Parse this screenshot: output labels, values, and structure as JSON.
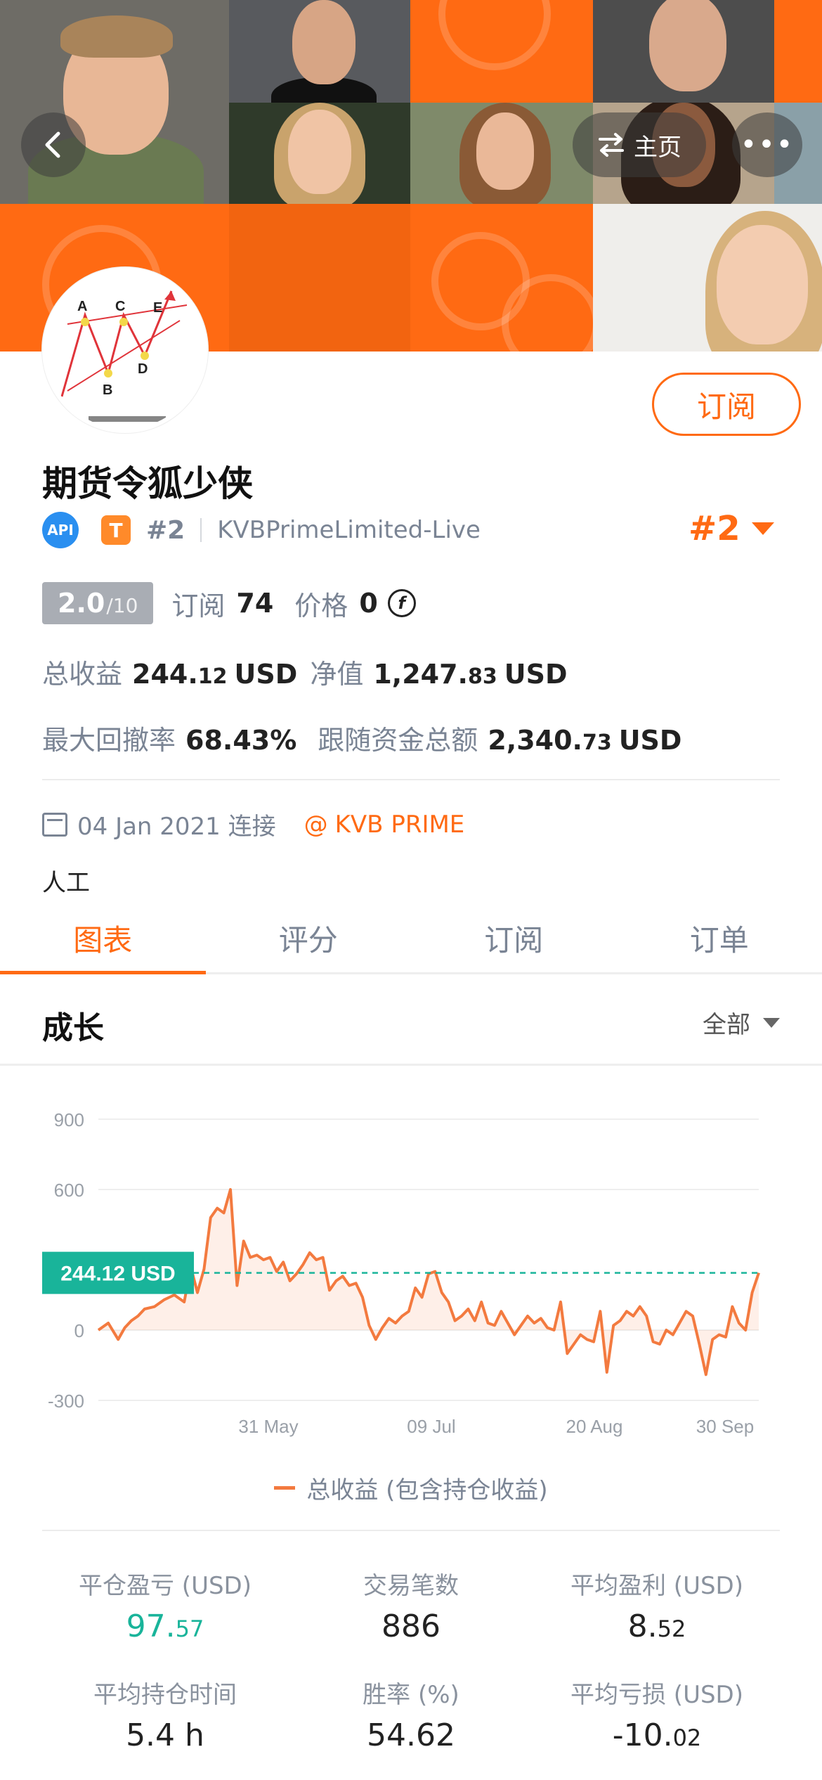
{
  "nav": {
    "home_label": "主页",
    "more_label": "•••"
  },
  "profile": {
    "subscribe_label": "订阅",
    "name": "期货令狐少侠",
    "api_badge": "API",
    "type_badge": "T",
    "rank_small": "#2",
    "server": "KVBPrimeLimited-Live",
    "rank_big": "#2",
    "score": "2.0",
    "score_max": "/10",
    "subscribers_label": "订阅",
    "subscribers": "74",
    "price_label": "价格",
    "price": "0",
    "total_profit_label": "总收益",
    "total_profit_int": "244.",
    "total_profit_dec": "12",
    "total_profit_cur": "USD",
    "equity_label": "净值",
    "equity_int": "1,247.",
    "equity_dec": "83",
    "equity_cur": "USD",
    "max_dd_label": "最大回撤率",
    "max_dd": "68.43%",
    "follow_label": "跟随资金总额",
    "follow_int": "2,340.",
    "follow_dec": "73",
    "follow_cur": "USD",
    "join_date": "04 Jan 2021 连接",
    "broker": "KVB PRIME",
    "strategy_type": "人工"
  },
  "tabs": [
    "图表",
    "评分",
    "订阅",
    "订单"
  ],
  "section": {
    "title": "成长",
    "range": "全部"
  },
  "chart_data": {
    "type": "line",
    "title": "",
    "y_ticks": [
      900,
      600,
      0,
      -300
    ],
    "x_labels": [
      "31 May",
      "09 Jul",
      "20 Aug",
      "30 Sep"
    ],
    "ylim": [
      -300,
      900
    ],
    "current_value_label": "244.12 USD",
    "current_value": 244.12,
    "series": [
      {
        "name": "总收益 (包含持仓收益)",
        "color": "#f37a3f",
        "x": [
          0,
          3,
          6,
          8,
          10,
          12,
          14,
          17,
          20,
          23,
          26,
          28,
          30,
          32,
          34,
          36,
          38,
          40,
          42,
          44,
          46,
          48,
          50,
          52,
          54,
          56,
          58,
          60,
          62,
          64,
          66,
          68,
          70,
          72,
          74,
          76,
          78,
          80,
          82,
          84,
          86,
          88,
          90,
          92,
          94,
          96,
          98,
          100,
          102,
          104,
          106,
          108,
          110,
          112,
          114,
          116,
          118,
          120,
          122,
          124,
          126,
          128,
          130,
          132,
          134,
          136,
          138,
          140,
          142,
          144,
          146,
          148,
          150,
          152,
          154,
          156,
          158,
          160,
          162,
          164,
          166,
          168,
          170,
          172,
          174,
          176,
          178,
          180,
          182,
          184,
          186,
          188,
          190,
          192,
          194,
          196,
          198,
          200
        ],
        "values": [
          0,
          30,
          -40,
          10,
          40,
          60,
          90,
          100,
          130,
          150,
          120,
          270,
          160,
          260,
          480,
          520,
          500,
          600,
          190,
          380,
          310,
          320,
          300,
          310,
          250,
          290,
          210,
          240,
          280,
          330,
          300,
          310,
          170,
          210,
          230,
          190,
          200,
          140,
          20,
          -40,
          10,
          50,
          30,
          60,
          80,
          180,
          140,
          240,
          250,
          160,
          120,
          40,
          60,
          90,
          40,
          120,
          30,
          20,
          80,
          30,
          -20,
          20,
          60,
          30,
          50,
          10,
          0,
          120,
          -100,
          -60,
          -20,
          -40,
          -50,
          80,
          -180,
          20,
          40,
          80,
          60,
          100,
          60,
          -50,
          -60,
          0,
          -20,
          30,
          80,
          60,
          -60,
          -190,
          -40,
          -20,
          -30,
          100,
          30,
          0,
          160,
          244.12
        ]
      }
    ]
  },
  "legend_label": "总收益 (包含持仓收益)",
  "metrics": [
    {
      "label": "平仓盈亏 (USD)",
      "int": "97.",
      "dec": "57",
      "color": "green"
    },
    {
      "label": "交易笔数",
      "int": "886",
      "dec": "",
      "color": "normal"
    },
    {
      "label": "平均盈利 (USD)",
      "int": "8.",
      "dec": "52",
      "color": "normal"
    },
    {
      "label": "平均持仓时间",
      "int": "5.4 h",
      "dec": "",
      "color": "normal"
    },
    {
      "label": "胜率 (%)",
      "int": "54.62",
      "dec": "",
      "color": "normal"
    },
    {
      "label": "平均亏损 (USD)",
      "int": "-10.",
      "dec": "02",
      "color": "normal"
    }
  ]
}
